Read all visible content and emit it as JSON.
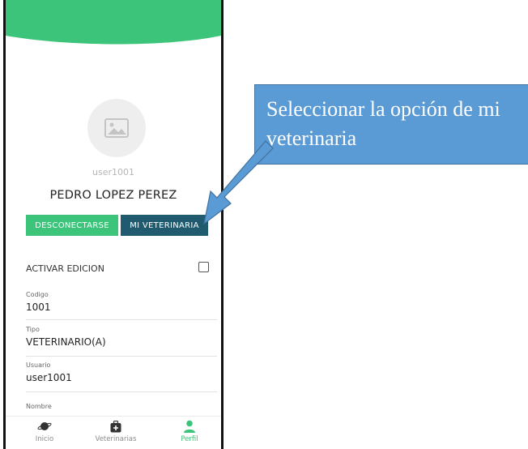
{
  "profile": {
    "username": "user1001",
    "full_name": "PEDRO LOPEZ PEREZ"
  },
  "actions": {
    "disconnect_label": "DESCONECTARSE",
    "my_vet_label": "MI VETERINARIA"
  },
  "edit": {
    "label": "ACTIVAR EDICION",
    "checked": false
  },
  "fields": [
    {
      "label": "Codigo",
      "value": "1001"
    },
    {
      "label": "Tipo",
      "value": "VETERINARIO(A)"
    },
    {
      "label": "Usuario",
      "value": "user1001"
    },
    {
      "label": "Nombre",
      "value": ""
    }
  ],
  "nav": {
    "items": [
      {
        "label": "Inicio",
        "icon": "planet-icon",
        "active": false
      },
      {
        "label": "Veterinarias",
        "icon": "medical-kit-icon",
        "active": false
      },
      {
        "label": "Perfil",
        "icon": "person-icon",
        "active": true
      }
    ]
  },
  "callout": {
    "text": "Seleccionar la opción de mi veterinaria"
  },
  "colors": {
    "brand_green": "#3cc47a",
    "dark_teal": "#1f5a6e",
    "callout_blue": "#5b9bd5"
  }
}
